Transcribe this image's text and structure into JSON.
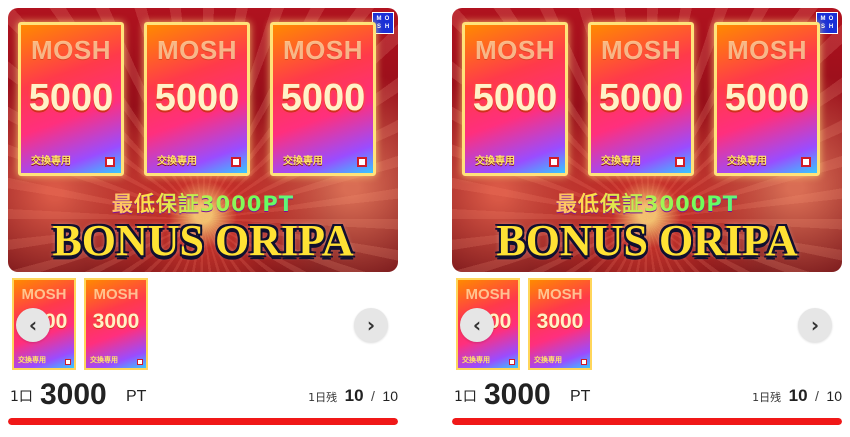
{
  "colors": {
    "progress": "#f01818",
    "ticket_border": "#ffe37a",
    "banner_bg": "#b0121f",
    "logo_bg": "#1a2fd6"
  },
  "products": [
    {
      "logo_letters": [
        "M",
        "O",
        "S",
        "H"
      ],
      "banner": {
        "tickets": [
          {
            "brand": "MOSH",
            "amount": "5000",
            "label": "交換専用"
          },
          {
            "brand": "MOSH",
            "amount": "5000",
            "label": "交換専用"
          },
          {
            "brand": "MOSH",
            "amount": "5000",
            "label": "交換専用"
          }
        ],
        "guarantee": "最低保証3000PT",
        "title": "BONUS ORIPA"
      },
      "thumbnails": [
        {
          "brand": "MOSH",
          "amount": "5000",
          "label": "交換専用"
        },
        {
          "brand": "MOSH",
          "amount": "3000",
          "label": "交換専用"
        }
      ],
      "prev_icon": "chevron-left-icon",
      "next_icon": "chevron-right-icon",
      "price": {
        "unit": "1口",
        "value": "3000",
        "currency": "PT"
      },
      "remaining": {
        "label": "1日残",
        "count": "10",
        "sep": "/",
        "total": "10",
        "fraction": 1.0
      }
    },
    {
      "logo_letters": [
        "M",
        "O",
        "S",
        "H"
      ],
      "banner": {
        "tickets": [
          {
            "brand": "MOSH",
            "amount": "5000",
            "label": "交換専用"
          },
          {
            "brand": "MOSH",
            "amount": "5000",
            "label": "交換専用"
          },
          {
            "brand": "MOSH",
            "amount": "5000",
            "label": "交換専用"
          }
        ],
        "guarantee": "最低保証3000PT",
        "title": "BONUS ORIPA"
      },
      "thumbnails": [
        {
          "brand": "MOSH",
          "amount": "5000",
          "label": "交換専用"
        },
        {
          "brand": "MOSH",
          "amount": "3000",
          "label": "交換専用"
        }
      ],
      "prev_icon": "chevron-left-icon",
      "next_icon": "chevron-right-icon",
      "price": {
        "unit": "1口",
        "value": "3000",
        "currency": "PT"
      },
      "remaining": {
        "label": "1日残",
        "count": "10",
        "sep": "/",
        "total": "10",
        "fraction": 1.0
      }
    }
  ]
}
